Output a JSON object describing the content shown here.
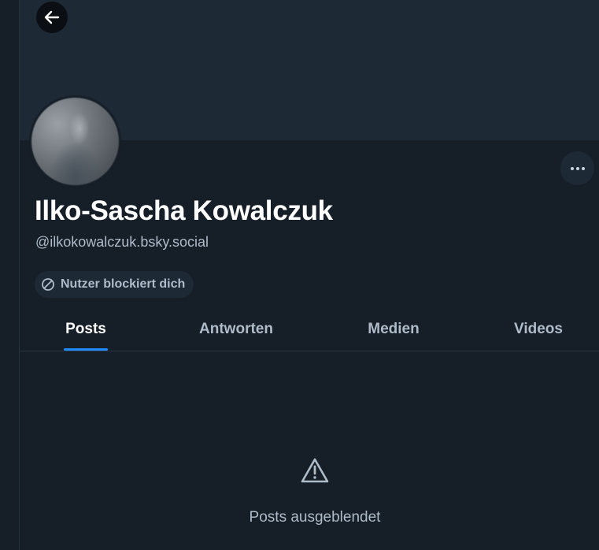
{
  "profile": {
    "display_name": "Ilko-Sascha Kowalczuk",
    "handle": "@ilkokowalczuk.bsky.social",
    "block_status": "Nutzer blockiert dich"
  },
  "tabs": [
    {
      "label": "Posts",
      "active": true
    },
    {
      "label": "Antworten",
      "active": false
    },
    {
      "label": "Medien",
      "active": false
    },
    {
      "label": "Videos",
      "active": false
    }
  ],
  "feed": {
    "empty_message": "Posts ausgeblendet",
    "empty_icon": "warning-icon"
  },
  "icons": {
    "back": "arrow-left-icon",
    "more": "ellipsis-icon",
    "block": "block-icon"
  },
  "colors": {
    "background": "#161e27",
    "banner": "#1e2936",
    "accent": "#208bfe",
    "muted_text": "#aebbc9"
  }
}
